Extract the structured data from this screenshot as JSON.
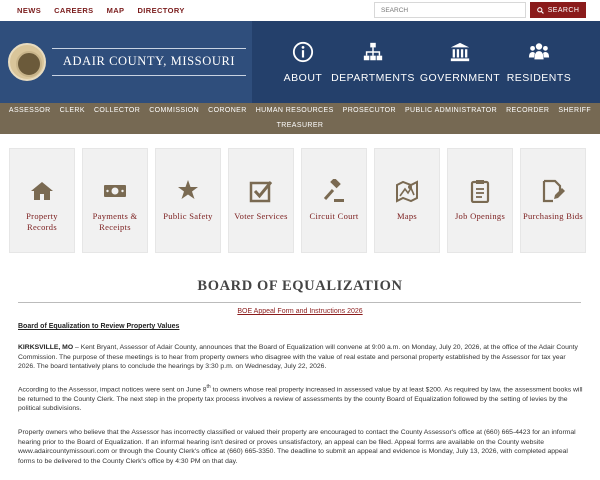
{
  "top_links": [
    "NEWS",
    "CAREERS",
    "MAP",
    "DIRECTORY"
  ],
  "search": {
    "placeholder": "SEARCH",
    "button_label": "SEARCH"
  },
  "header": {
    "county_title": "ADAIR COUNTY, MISSOURI",
    "nav": [
      {
        "label": "ABOUT",
        "icon": "info-icon"
      },
      {
        "label": "DEPARTMENTS",
        "icon": "org-chart-icon"
      },
      {
        "label": "GOVERNMENT",
        "icon": "capitol-icon"
      },
      {
        "label": "RESIDENTS",
        "icon": "people-icon"
      }
    ]
  },
  "departments_row1": [
    "ASSESSOR",
    "CLERK",
    "COLLECTOR",
    "COMMISSION",
    "CORONER",
    "HUMAN RESOURCES",
    "PROSECUTOR",
    "PUBLIC ADMINISTRATOR",
    "RECORDER",
    "SHERIFF"
  ],
  "departments_row2": [
    "TREASURER"
  ],
  "tiles": [
    {
      "label": "Property Records",
      "icon": "house-icon"
    },
    {
      "label": "Payments & Receipts",
      "icon": "money-icon"
    },
    {
      "label": "Public Safety",
      "icon": "badge-star-icon"
    },
    {
      "label": "Voter Services",
      "icon": "checkbox-icon"
    },
    {
      "label": "Circuit Court",
      "icon": "gavel-icon"
    },
    {
      "label": "Maps",
      "icon": "map-icon"
    },
    {
      "label": "Job Openings",
      "icon": "clipboard-icon"
    },
    {
      "label": "Purchasing Bids",
      "icon": "document-edit-icon"
    }
  ],
  "content": {
    "page_title": "BOARD OF EQUALIZATION",
    "boe_link": "BOE Appeal Form and Instructions 2026",
    "subhead": "Board of Equalization to Review Property Values",
    "p1_lead": "KIRKSVILLE, MO",
    "p1_text": " – Kent Bryant, Assessor of Adair County, announces that the Board of Equalization will convene at 9:00 a.m. on Monday, July 20, 2026, at the office of the Adair County Commission. The purpose of these meetings is to hear from property owners who disagree with the value of real estate and personal property established by the Assessor for tax year 2026. The board tentatively plans to conclude the hearings by 3:30 p.m. on Wednesday, July 22, 2026.",
    "p2_before": "According to the Assessor, impact notices were sent on June 8",
    "p2_sup": "th",
    "p2_after": " to owners whose real property increased in assessed value by at least $200. As required by law, the assessment books will be returned to the County Clerk. The next step in the property tax process involves a review of assessments by the county Board of Equalization followed by the setting of levies by the political subdivisions.",
    "p3_text": "Property owners who believe that the Assessor has incorrectly classified or valued their property are encouraged to contact the County Assessor's office at (660) 665-4423 for an informal hearing prior to the Board of Equalization. If an informal hearing isn't desired or proves unsatisfactory, an appeal can be filed. Appeal forms are available on the County website www.adaircountymissouri.com or through the County Clerk's office at (660) 665-3350. The deadline to submit an appeal and evidence is Monday, July 13, 2026, with completed appeal forms to be delivered to the County Clerk's office by 4:30 PM on that day."
  },
  "colors": {
    "maroon": "#8a1b1b",
    "navy": "#24406b",
    "navy_light": "#2f4e7c",
    "taupe": "#766953",
    "tile_bg": "#f1f1f1",
    "icon_brown": "#7a6a52"
  }
}
